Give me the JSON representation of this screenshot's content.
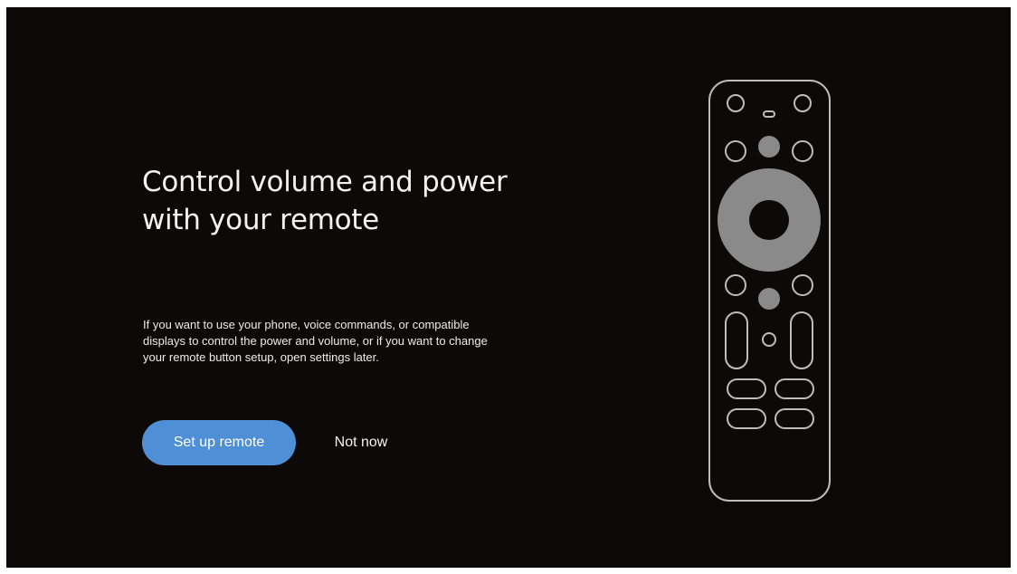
{
  "setup": {
    "title": "Control volume and power with your remote",
    "description": "If you want to use your phone, voice commands, or compatible displays to control the power and volume, or if you want to change your remote button setup, open settings later.",
    "primary_button_label": "Set up remote",
    "secondary_button_label": "Not now"
  },
  "illustration": {
    "icon": "tv-remote-illustration"
  },
  "colors": {
    "background": "#0d0908",
    "primary_button": "#4f8fd6",
    "remote_outline": "#bdbdbd",
    "remote_fill": "#8a8a8a"
  }
}
